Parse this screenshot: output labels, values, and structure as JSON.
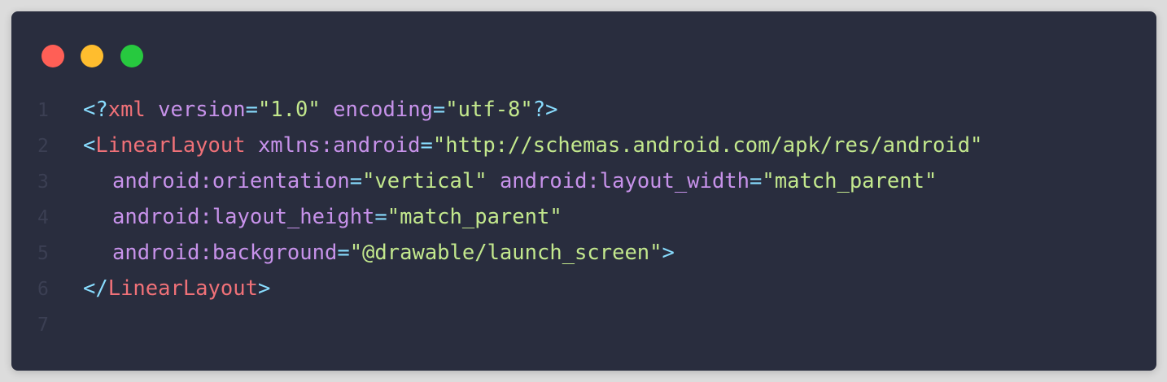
{
  "window": {
    "controls": [
      "close",
      "minimize",
      "maximize"
    ],
    "colors": {
      "background": "#292d3e",
      "close": "#ff5f56",
      "minimize": "#ffbd2e",
      "maximize": "#27c93f",
      "punctuation": "#89ddff",
      "tag": "#f07178",
      "attribute": "#c792ea",
      "string": "#c3e88d",
      "line_number": "#3b3f53"
    }
  },
  "code": {
    "lines": [
      {
        "number": "1",
        "tokens": [
          "<?",
          "xml",
          " ",
          "version",
          "=",
          "\"1.0\"",
          " ",
          "encoding",
          "=",
          "\"utf-8\"",
          "?>"
        ]
      },
      {
        "number": "2",
        "tokens": [
          "<",
          "LinearLayout",
          " ",
          "xmlns:android",
          "=",
          "\"http://schemas.android.com/apk/res/android\""
        ]
      },
      {
        "number": "3",
        "tokens": [
          "android:orientation",
          "=",
          "\"vertical\"",
          " ",
          "android:layout_width",
          "=",
          "\"match_parent\""
        ]
      },
      {
        "number": "4",
        "tokens": [
          "android:layout_height",
          "=",
          "\"match_parent\""
        ]
      },
      {
        "number": "5",
        "tokens": [
          "android:background",
          "=",
          "\"@drawable/launch_screen\"",
          ">"
        ]
      },
      {
        "number": "6",
        "tokens": [
          "</",
          "LinearLayout",
          ">"
        ]
      },
      {
        "number": "7",
        "tokens": []
      }
    ]
  }
}
